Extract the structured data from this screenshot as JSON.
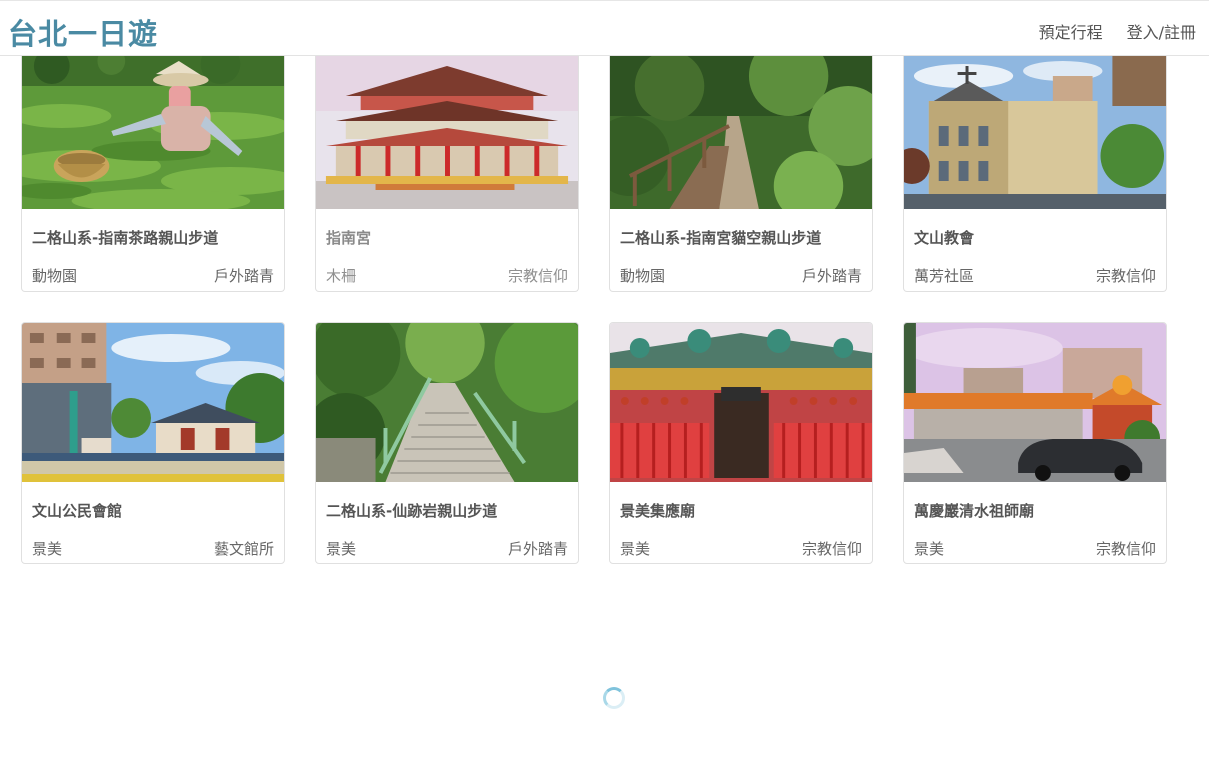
{
  "header": {
    "brand": "台北一日遊",
    "nav": [
      {
        "label": "預定行程"
      },
      {
        "label": "登入/註冊"
      }
    ]
  },
  "attractions": [
    {
      "name": "二格山系-指南茶路親山步道",
      "mrt": "動物園",
      "category": "戶外踏青",
      "image": "tea-plantation-picker"
    },
    {
      "name": "指南宮",
      "mrt": "木柵",
      "category": "宗教信仰",
      "image": "temple-palace"
    },
    {
      "name": "二格山系-指南宮貓空親山步道",
      "mrt": "動物園",
      "category": "戶外踏青",
      "image": "forest-trail"
    },
    {
      "name": "文山教會",
      "mrt": "萬芳社區",
      "category": "宗教信仰",
      "image": "church-building"
    },
    {
      "name": "文山公民會館",
      "mrt": "景美",
      "category": "藝文館所",
      "image": "community-hall"
    },
    {
      "name": "二格山系-仙跡岩親山步道",
      "mrt": "景美",
      "category": "戶外踏青",
      "image": "stone-staircase"
    },
    {
      "name": "景美集應廟",
      "mrt": "景美",
      "category": "宗教信仰",
      "image": "red-temple-gate"
    },
    {
      "name": "萬慶巖清水祖師廟",
      "mrt": "景美",
      "category": "宗教信仰",
      "image": "temple-with-cars"
    }
  ],
  "loading": {
    "icon": "loading-spinner-icon"
  },
  "colors": {
    "brand": "#4a8aa3",
    "text": "#555555",
    "muted": "#8a8a8a",
    "border": "#e0e0e0"
  }
}
